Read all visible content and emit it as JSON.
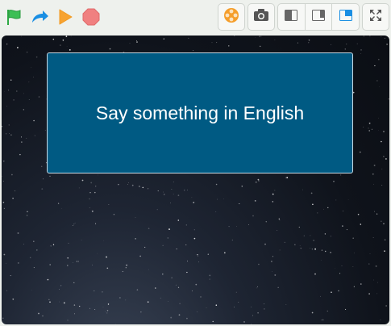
{
  "toolbar": {
    "green_flag_icon": "green-flag-icon",
    "step_icon": "redo-arrow-icon",
    "play_icon": "play-icon",
    "stop_icon": "stop-icon",
    "buttons": [
      {
        "name": "tilt-icon",
        "color": "#f59e2b"
      },
      {
        "name": "camera-icon",
        "color": "#555555"
      }
    ],
    "layout_buttons": [
      {
        "name": "small-stage-icon"
      },
      {
        "name": "normal-stage-icon"
      },
      {
        "name": "large-stage-icon",
        "active": true
      }
    ],
    "fullscreen_icon": "fullscreen-icon"
  },
  "stage": {
    "ask_prompt": "Say something in English",
    "ask_box_color": "#005a83"
  },
  "colors": {
    "flag": "#2eaa45",
    "arrow": "#1a8fe3",
    "play": "#f7a331",
    "stop": "#ef7f7f",
    "accent": "#1a8fe3"
  }
}
